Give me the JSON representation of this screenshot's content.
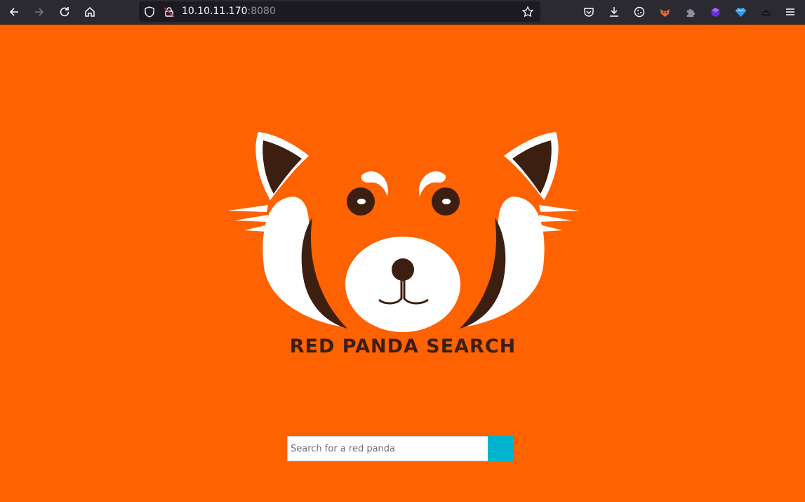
{
  "browser": {
    "url_host": "10.10.11.170",
    "url_port": ":8080",
    "icons": {
      "back": "back-arrow-icon",
      "forward": "forward-arrow-icon",
      "reload": "reload-icon",
      "home": "home-icon",
      "tracking_protection": "shield-icon",
      "connection": "insecure-lock-icon",
      "bookmark": "star-icon",
      "pocket": "pocket-icon",
      "downloads": "download-icon",
      "cookies": "cookie-icon",
      "menu": "hamburger-menu-icon"
    },
    "extensions": [
      "foxyproxy-icon",
      "extension-puzzle-icon",
      "cube-extension-icon",
      "gem-extension-icon",
      "hat-extension-icon"
    ]
  },
  "page": {
    "background_color": "#ff6200",
    "logo": {
      "title_text": "RED PANDA SEARCH",
      "colors": {
        "dark_brown": "#3d1f12",
        "white": "#ffffff",
        "orange": "#ff6200"
      }
    },
    "search": {
      "placeholder": "Search for a red panda",
      "value": "",
      "button_color": "#00b4cc"
    }
  }
}
